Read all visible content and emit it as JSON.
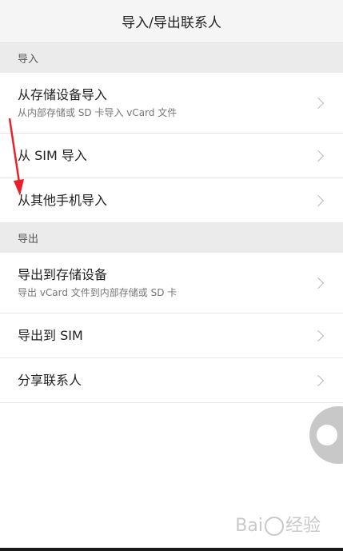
{
  "header": {
    "title": "导入/导出联系人"
  },
  "sections": {
    "import": {
      "label": "导入",
      "items": [
        {
          "label": "从存储设备导入",
          "sub": "从内部存储或 SD 卡导入 vCard 文件"
        },
        {
          "label": "从 SIM 导入"
        },
        {
          "label": "从其他手机导入"
        }
      ]
    },
    "export": {
      "label": "导出",
      "items": [
        {
          "label": "导出到存储设备",
          "sub": "导出 vCard 文件到内部存储或 SD 卡"
        },
        {
          "label": "导出到 SIM"
        },
        {
          "label": "分享联系人"
        }
      ]
    }
  },
  "watermark": {
    "text": "Bai",
    "text2": "经验"
  },
  "colors": {
    "annotation_arrow": "#e8202a",
    "section_bg": "#ebebeb",
    "titlebar_bg": "#f5f5f5"
  },
  "icons": {
    "chevron": "chevron-right-icon",
    "float": "floating-assistive-ball-icon"
  }
}
